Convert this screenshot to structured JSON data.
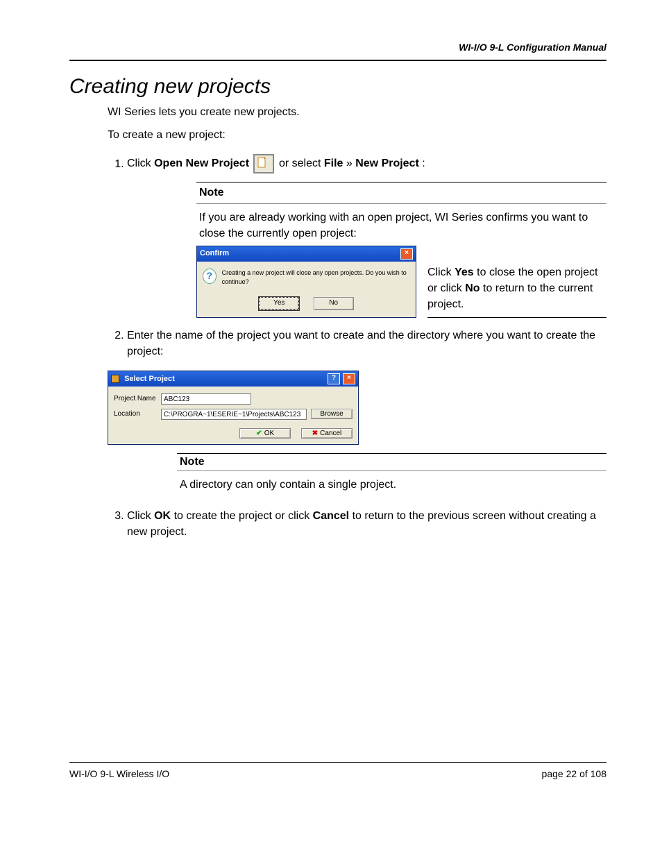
{
  "header": {
    "manual_title": "WI-I/O 9-L Configuration Manual"
  },
  "section": {
    "title": "Creating new projects"
  },
  "intro": {
    "line1": "WI Series lets you create new projects.",
    "line2": "To create a new project:"
  },
  "steps": {
    "s1": {
      "pre": "Click ",
      "b1": "Open New Project",
      "mid": " or select ",
      "b2": "File",
      "sep": " » ",
      "b3": "New Project",
      "post": ":"
    },
    "s2": "Enter the name of the project you want to create and the directory where you want to create the project:",
    "s3": {
      "pre": "Click ",
      "b1": "OK",
      "mid": " to create the project or click ",
      "b2": "Cancel",
      "post": " to return to the previous screen without creating a new project."
    }
  },
  "note1": {
    "label": "Note",
    "body": "If you are already working with an open project, WI Series confirms you want to close the currently open project:"
  },
  "confirm_dialog": {
    "title": "Confirm",
    "message": "Creating a new project will close any open projects.  Do you wish to continue?",
    "yes": "Yes",
    "no": "No"
  },
  "confirm_side": {
    "pre": "Click ",
    "b1": "Yes",
    "mid": " to close the open project or click ",
    "b2": "No",
    "post": " to return to the current project."
  },
  "select_dialog": {
    "title": "Select Project",
    "project_name_label": "Project Name",
    "project_name_value": "ABC123",
    "location_label": "Location",
    "location_value": "C:\\PROGRA~1\\ESERIE~1\\Projects\\ABC123",
    "browse": "Browse",
    "ok": "OK",
    "cancel": "Cancel"
  },
  "note2": {
    "label": "Note",
    "body": "A directory can only contain a single project."
  },
  "footer": {
    "left": "WI-I/O 9-L Wireless I/O",
    "right_pre": "page ",
    "page_current": "22",
    "right_mid": " of ",
    "page_total": "108"
  }
}
